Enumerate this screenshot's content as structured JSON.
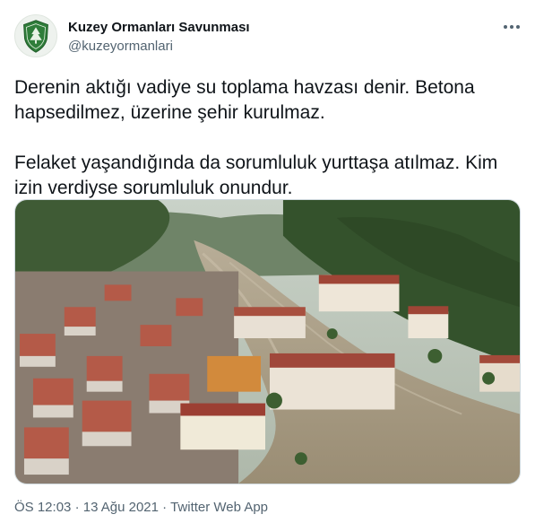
{
  "tweet": {
    "author_name": "Kuzey Ormanları Savunması",
    "author_handle": "@kuzeyormanlari",
    "avatar_icon": "forest-defense-logo-icon",
    "more_icon": "more-options-icon",
    "paragraphs": [
      "Derenin aktığı vadiye su toplama havzası denir. Betona hapsedilmez, üzerine şehir kurulmaz.",
      "Felaket yaşandığında da sorumluluk yurttaşa atılmaz. Kim izin verdiyse sorumluluk onundur."
    ],
    "photo": "aerial view of a flooded valley town with muddy river water between buildings and forested hills",
    "time": "ÖS 12:03",
    "separator": "·",
    "date": "13 Ağu 2021",
    "source": "Twitter Web App"
  },
  "colors": {
    "text": "#0f1419",
    "secondary": "#536471",
    "avatar_green": "#2f7d3a",
    "flood_water": "#a79c86",
    "forest": "#3b5a2f"
  }
}
